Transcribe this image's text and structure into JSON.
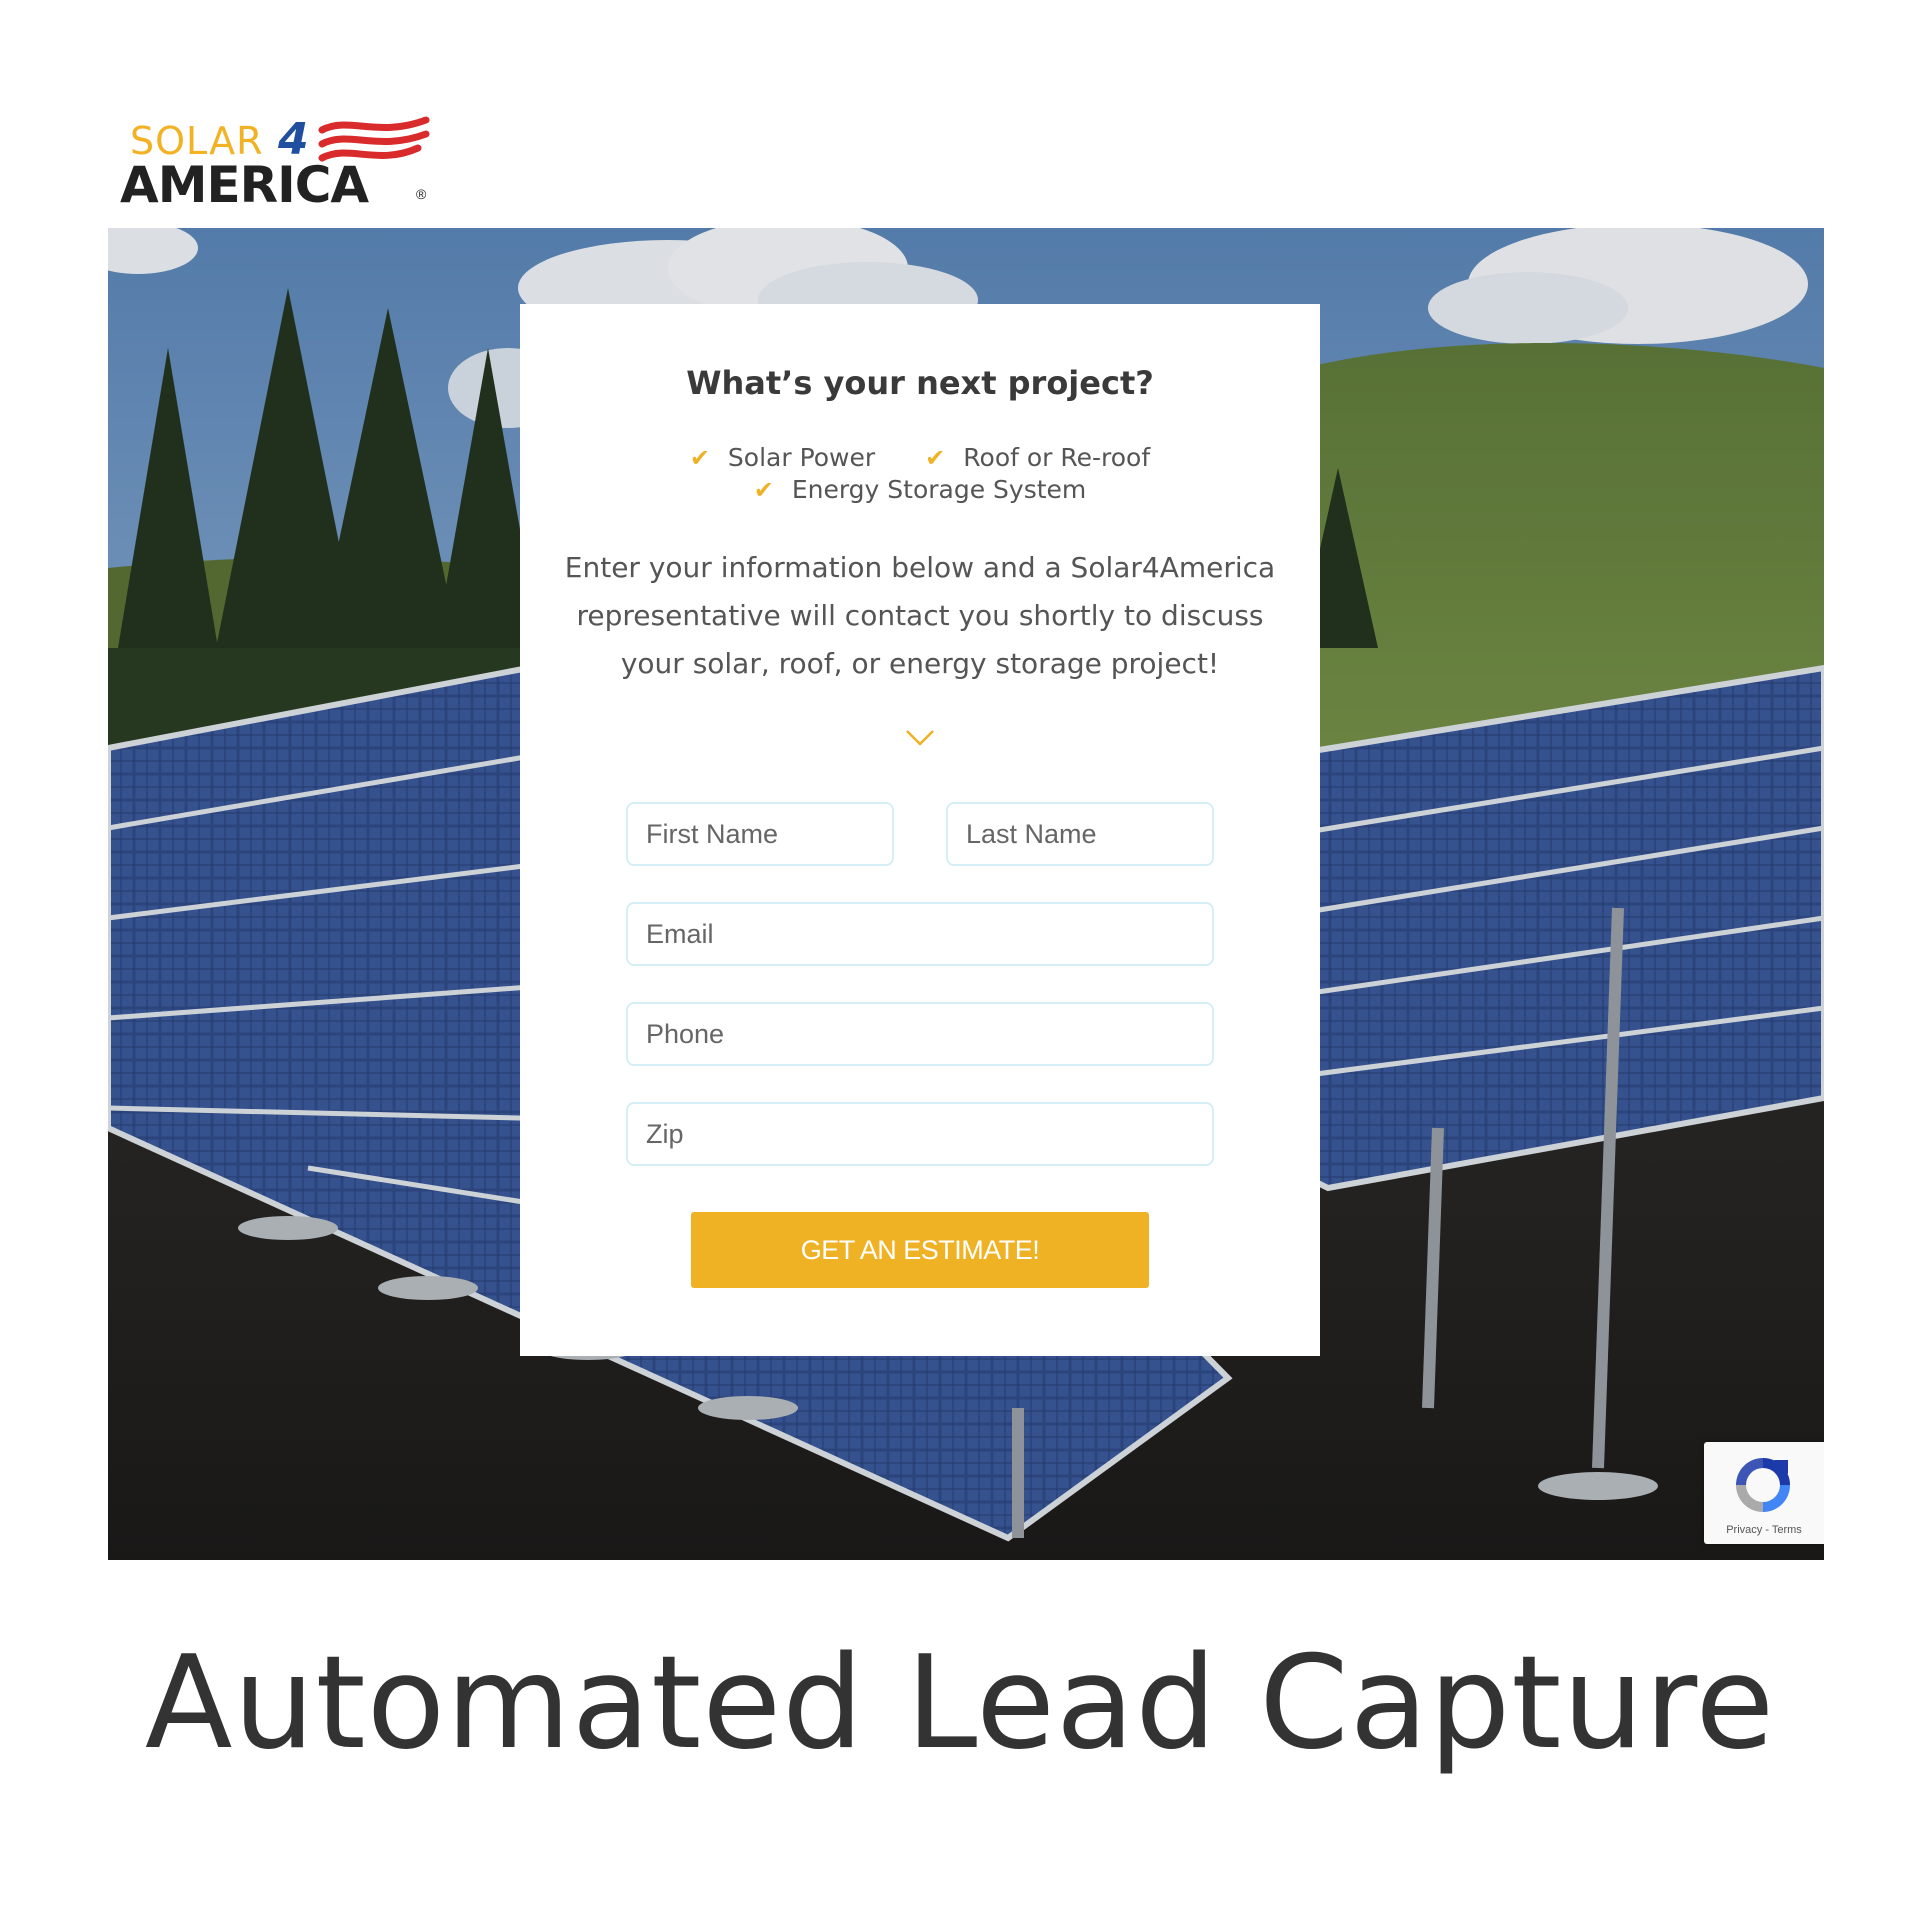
{
  "logo": {
    "word_solar": "SOLAR",
    "word_four": "4",
    "word_america": "AMERICA",
    "registered": "®",
    "colors": {
      "solar": "#f2b224",
      "four": "#1f4f9e",
      "flag_red": "#d92b2b",
      "america": "#222222"
    }
  },
  "hero": {
    "background_icon": "solar-panel-field-photo"
  },
  "form": {
    "title": "What’s your next project?",
    "checks": [
      {
        "icon": "check-icon",
        "label": "Solar Power"
      },
      {
        "icon": "check-icon",
        "label": "Roof or Re-roof"
      },
      {
        "icon": "check-icon",
        "label": "Energy Storage System"
      }
    ],
    "description": "Enter your information below and a Solar4America representative will contact you shortly to discuss your solar, roof, or energy storage project!",
    "first_name_placeholder": "First Name",
    "last_name_placeholder": "Last Name",
    "email_placeholder": "Email",
    "phone_placeholder": "Phone",
    "zip_placeholder": "Zip",
    "submit_label": "GET AN ESTIMATE!",
    "accent_color": "#f0b225"
  },
  "recaptcha": {
    "links": "Privacy - Terms",
    "icon": "recaptcha-icon"
  },
  "caption": {
    "text": "Automated Lead Capture"
  }
}
